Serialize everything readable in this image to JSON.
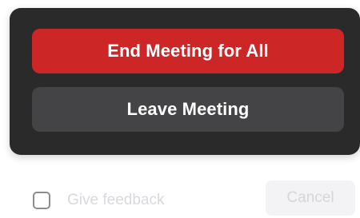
{
  "dialog": {
    "end_for_all_label": "End Meeting for All",
    "leave_label": "Leave Meeting"
  },
  "footer": {
    "feedback_label": "Give feedback",
    "feedback_checked": false,
    "cancel_label": "Cancel"
  },
  "colors": {
    "danger": "#cd2626",
    "panel": "#2a2a2b",
    "secondary_button": "#444446"
  }
}
